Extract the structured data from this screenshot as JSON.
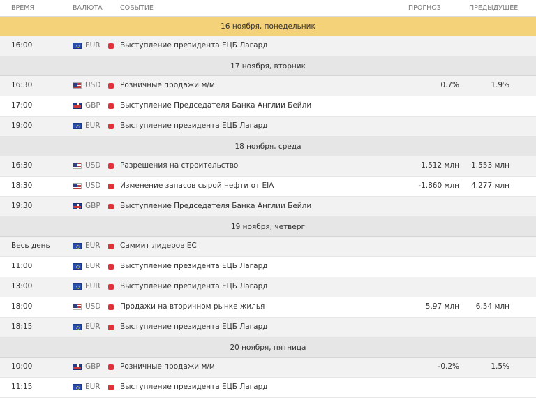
{
  "header": {
    "time": "ВРЕМЯ",
    "currency": "ВАЛЮТА",
    "event": "СОБЫТИЕ",
    "forecast": "ПРОГНОЗ",
    "previous": "ПРЕДЫДУЩЕЕ"
  },
  "colors": {
    "active_day": "#f4d27a",
    "day": "#e6e6e6",
    "importance": "#e0323a"
  },
  "days": [
    {
      "label": "16 ноября, понедельник",
      "active": true,
      "events": [
        {
          "time": "16:00",
          "flag": "eu",
          "currency": "EUR",
          "event": "Выступление президента ЕЦБ Лагард",
          "forecast": "",
          "previous": ""
        }
      ]
    },
    {
      "label": "17 ноября, вторник",
      "active": false,
      "events": [
        {
          "time": "16:30",
          "flag": "us",
          "currency": "USD",
          "event": "Розничные продажи м/м",
          "forecast": "0.7%",
          "previous": "1.9%"
        },
        {
          "time": "17:00",
          "flag": "gb",
          "currency": "GBP",
          "event": "Выступление Председателя Банка Англии Бейли",
          "forecast": "",
          "previous": ""
        },
        {
          "time": "19:00",
          "flag": "eu",
          "currency": "EUR",
          "event": "Выступление президента ЕЦБ Лагард",
          "forecast": "",
          "previous": ""
        }
      ]
    },
    {
      "label": "18 ноября, среда",
      "active": false,
      "events": [
        {
          "time": "16:30",
          "flag": "us",
          "currency": "USD",
          "event": "Разрешения на строительство",
          "forecast": "1.512 млн",
          "previous": "1.553 млн"
        },
        {
          "time": "18:30",
          "flag": "us",
          "currency": "USD",
          "event": "Изменение запасов сырой нефти от EIA",
          "forecast": "-1.860 млн",
          "previous": "4.277 млн"
        },
        {
          "time": "19:30",
          "flag": "gb",
          "currency": "GBP",
          "event": "Выступление Председателя Банка Англии Бейли",
          "forecast": "",
          "previous": ""
        }
      ]
    },
    {
      "label": "19 ноября, четверг",
      "active": false,
      "events": [
        {
          "time": "Весь день",
          "flag": "eu",
          "currency": "EUR",
          "event": "Саммит лидеров ЕС",
          "forecast": "",
          "previous": ""
        },
        {
          "time": "11:00",
          "flag": "eu",
          "currency": "EUR",
          "event": "Выступление президента ЕЦБ Лагард",
          "forecast": "",
          "previous": ""
        },
        {
          "time": "13:00",
          "flag": "eu",
          "currency": "EUR",
          "event": "Выступление президента ЕЦБ Лагард",
          "forecast": "",
          "previous": ""
        },
        {
          "time": "18:00",
          "flag": "us",
          "currency": "USD",
          "event": "Продажи на вторичном рынке жилья",
          "forecast": "5.97 млн",
          "previous": "6.54 млн"
        },
        {
          "time": "18:15",
          "flag": "eu",
          "currency": "EUR",
          "event": "Выступление президента ЕЦБ Лагард",
          "forecast": "",
          "previous": ""
        }
      ]
    },
    {
      "label": "20 ноября, пятница",
      "active": false,
      "events": [
        {
          "time": "10:00",
          "flag": "gb",
          "currency": "GBP",
          "event": "Розничные продажи м/м",
          "forecast": "-0.2%",
          "previous": "1.5%"
        },
        {
          "time": "11:15",
          "flag": "eu",
          "currency": "EUR",
          "event": "Выступление президента ЕЦБ Лагард",
          "forecast": "",
          "previous": ""
        }
      ]
    }
  ]
}
